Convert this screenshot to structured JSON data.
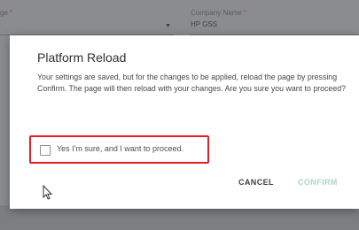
{
  "background": {
    "left_field_label": "ge",
    "left_field_required": "*",
    "right_field_label": "Company Name",
    "right_field_required": "*",
    "right_field_value": "HP GSS",
    "dropdown_caret": "▼"
  },
  "dialog": {
    "title": "Platform Reload",
    "message": "Your settings are saved, but for the changes to be applied, reload the page by pressing Confirm. The page will then reload with your changes. Are you sure you want to proceed?",
    "checkbox_label": "Yes I'm sure, and I want to proceed.",
    "checkbox_checked": false,
    "cancel_label": "CANCEL",
    "confirm_label": "CONFIRM"
  },
  "colors": {
    "highlight_border": "#e01f2a",
    "confirm_disabled": "#a7d8c4",
    "overlay": "#8a8c8e"
  }
}
